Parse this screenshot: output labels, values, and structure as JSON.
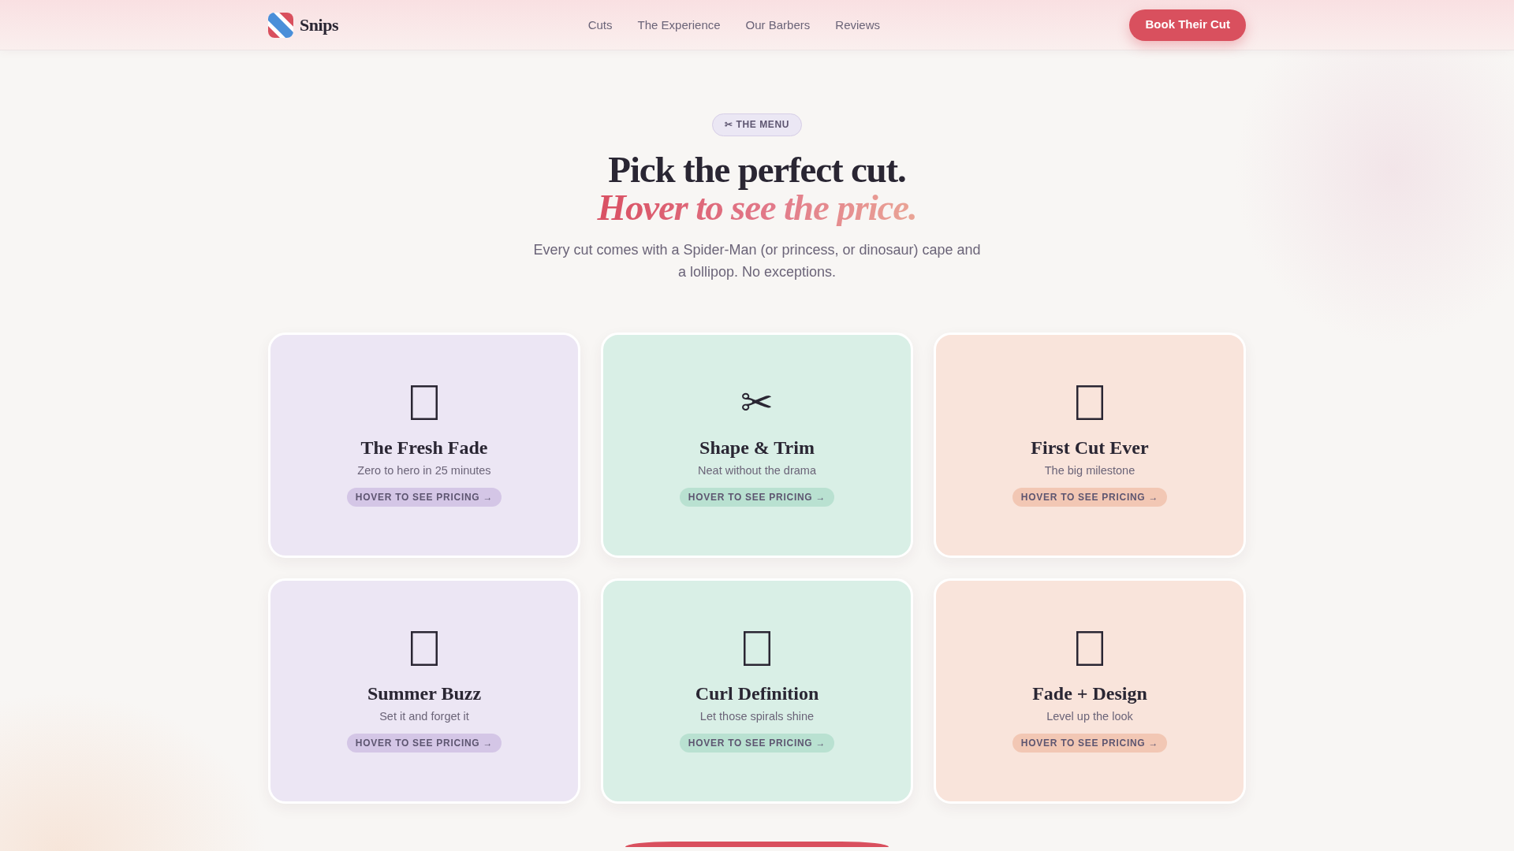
{
  "brand": {
    "name": "Snips"
  },
  "nav": {
    "links": [
      {
        "label": "Cuts"
      },
      {
        "label": "The Experience"
      },
      {
        "label": "Our Barbers"
      },
      {
        "label": "Reviews"
      }
    ],
    "cta": "Book Their Cut"
  },
  "hero": {
    "badge": "✂ THE MENU",
    "title": "Pick the perfect cut.",
    "title_accent": "Hover to see the price.",
    "lead": "Every cut comes with a Spider-Man (or princess, or dinosaur) cape and a lollipop. No exceptions."
  },
  "cuts": [
    {
      "kind": "tofu",
      "name": "The Fresh Fade",
      "tagline": "Zero to hero in 25 minutes",
      "hint": "HOVER TO SEE PRICING →",
      "color": "#ece6f4"
    },
    {
      "kind": "glyph",
      "icon": "✂",
      "name": "Shape & Trim",
      "tagline": "Neat without the drama",
      "hint": "HOVER TO SEE PRICING →",
      "color": "#d9efe6"
    },
    {
      "kind": "tofu",
      "name": "First Cut Ever",
      "tagline": "The big milestone",
      "hint": "HOVER TO SEE PRICING →",
      "color": "#f9e4db"
    },
    {
      "kind": "tofu",
      "name": "Summer Buzz",
      "tagline": "Set it and forget it",
      "hint": "HOVER TO SEE PRICING →",
      "color": "#ece6f4"
    },
    {
      "kind": "tofu",
      "name": "Curl Definition",
      "tagline": "Let those spirals shine",
      "hint": "HOVER TO SEE PRICING →",
      "color": "#d9efe6"
    },
    {
      "kind": "tofu",
      "name": "Fade + Design",
      "tagline": "Level up the look",
      "hint": "HOVER TO SEE PRICING →",
      "color": "#f9e4db"
    }
  ]
}
